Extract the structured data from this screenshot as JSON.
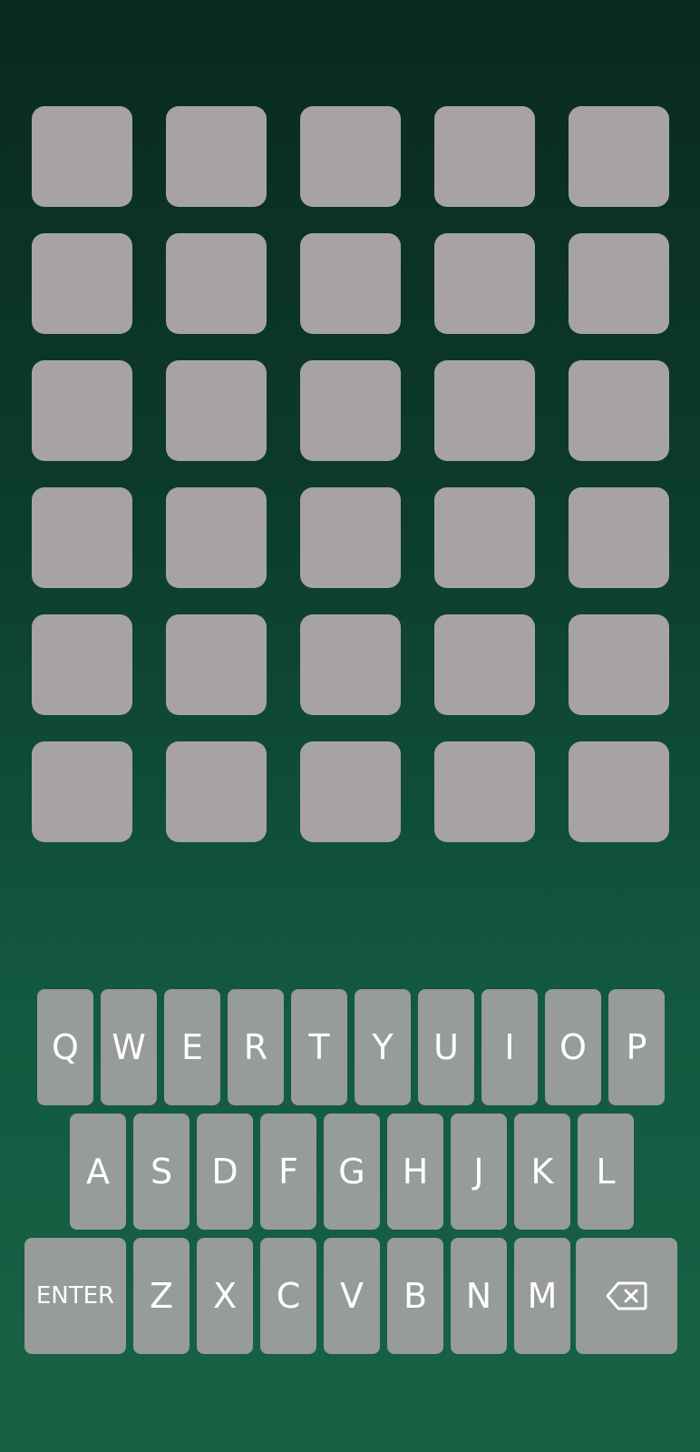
{
  "board": {
    "rows": [
      [
        "",
        "",
        "",
        "",
        ""
      ],
      [
        "",
        "",
        "",
        "",
        ""
      ],
      [
        "",
        "",
        "",
        "",
        ""
      ],
      [
        "",
        "",
        "",
        "",
        ""
      ],
      [
        "",
        "",
        "",
        "",
        ""
      ],
      [
        "",
        "",
        "",
        "",
        ""
      ]
    ]
  },
  "keyboard": {
    "row1": [
      "Q",
      "W",
      "E",
      "R",
      "T",
      "Y",
      "U",
      "I",
      "O",
      "P"
    ],
    "row2": [
      "A",
      "S",
      "D",
      "F",
      "G",
      "H",
      "J",
      "K",
      "L"
    ],
    "row3": [
      "Z",
      "X",
      "C",
      "V",
      "B",
      "N",
      "M"
    ],
    "enter_label": "ENTER",
    "backspace_icon": "backspace-icon"
  },
  "colors": {
    "tile_empty": "#a7a3a4",
    "key_bg": "#979b9a",
    "background_top": "#0a2a1e",
    "background_bottom": "#176245"
  }
}
